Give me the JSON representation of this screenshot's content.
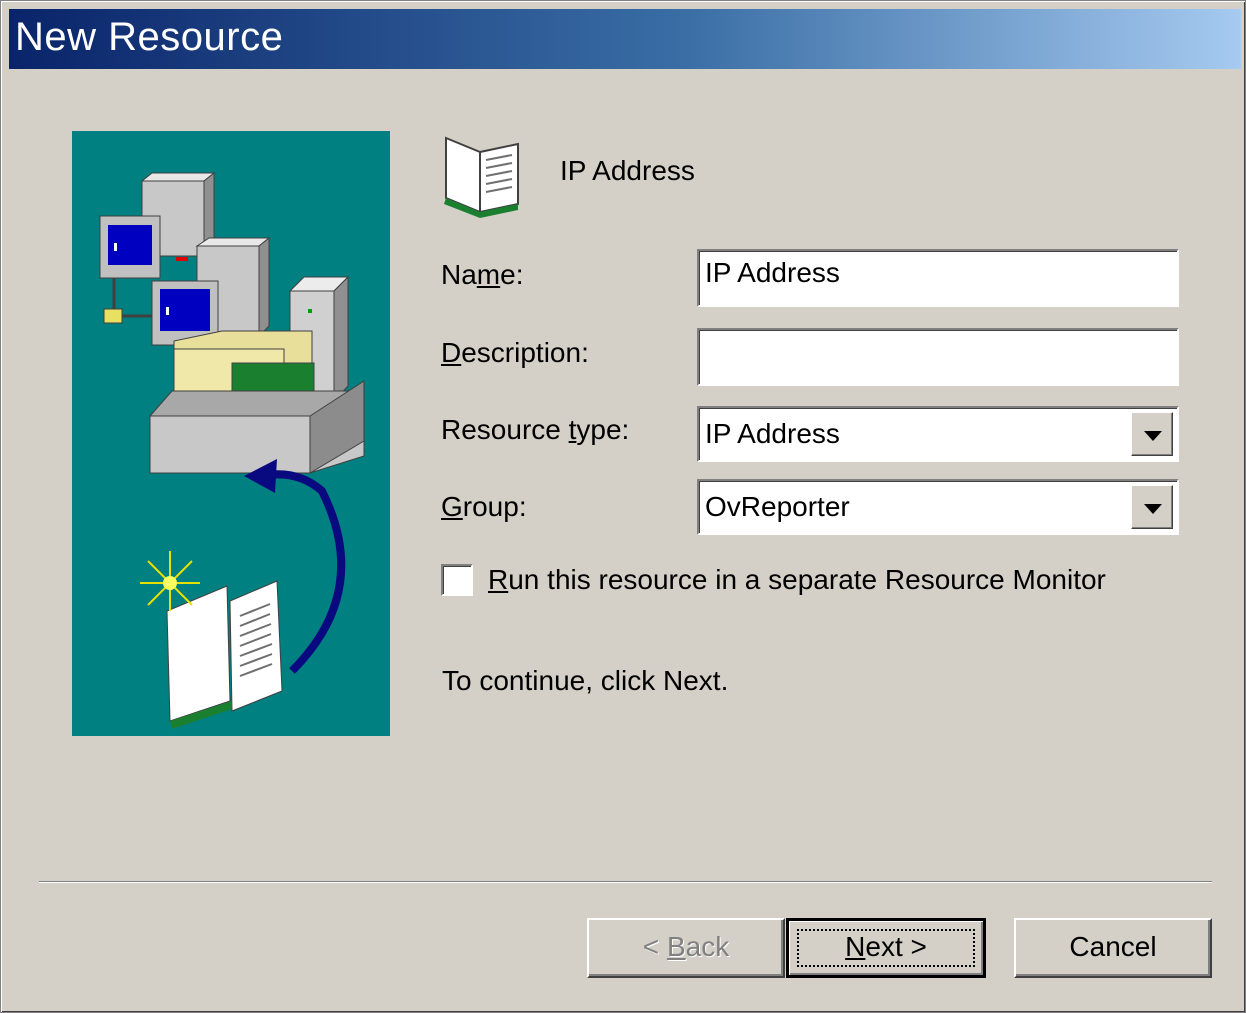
{
  "window": {
    "title": "New Resource"
  },
  "header": {
    "icon": "open-book-icon",
    "title": "IP Address"
  },
  "form": {
    "name": {
      "label_pre": "Na",
      "label_key": "m",
      "label_post": "e:",
      "value": "IP Address"
    },
    "description": {
      "label_pre": "",
      "label_key": "D",
      "label_post": "escription:",
      "value": ""
    },
    "resource_type": {
      "label_pre": "Resource ",
      "label_key": "t",
      "label_post": "ype:",
      "value": "IP Address"
    },
    "group": {
      "label_pre": "",
      "label_key": "G",
      "label_post": "roup:",
      "value": "OvReporter"
    },
    "separate_monitor": {
      "label_key": "R",
      "label_post": "un this resource in a separate Resource Monitor",
      "checked": false
    }
  },
  "hint": "To continue, click Next.",
  "buttons": {
    "back": {
      "pre": "< ",
      "key": "B",
      "post": "ack",
      "enabled": false
    },
    "next": {
      "key": "N",
      "post": "ext >"
    },
    "cancel": {
      "label": "Cancel"
    }
  },
  "colors": {
    "title_start": "#0a246a",
    "title_end": "#a6caf0",
    "illustration_bg": "#008080",
    "face": "#d4d0c8"
  }
}
